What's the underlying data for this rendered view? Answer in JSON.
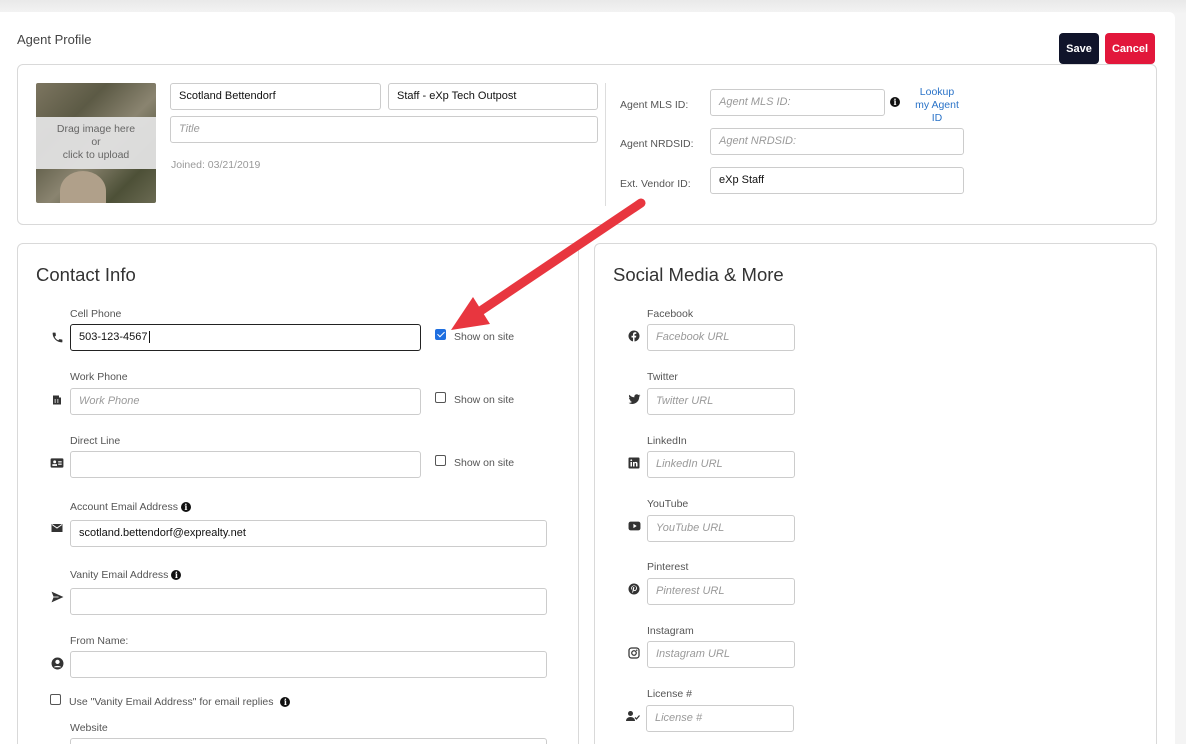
{
  "header": {
    "title": "Agent Profile",
    "save_label": "Save",
    "cancel_label": "Cancel"
  },
  "profile": {
    "photo_hint": [
      "Drag image here",
      "or",
      "click to upload"
    ],
    "name_value": "Scotland Bettendorf",
    "office_value": "Staff - eXp Tech Outpost",
    "title_placeholder": "Title",
    "joined": "Joined: 03/21/2019",
    "mls_label": "Agent MLS ID:",
    "mls_placeholder": "Agent MLS ID:",
    "lookup_link": [
      "Lookup",
      "my Agent",
      "ID"
    ],
    "nrdsid_label": "Agent NRDSID:",
    "nrdsid_placeholder": "Agent NRDSID:",
    "vendor_label": "Ext. Vendor ID:",
    "vendor_value": "eXp Staff"
  },
  "contact": {
    "title": "Contact Info",
    "cell_label": "Cell Phone",
    "cell_value": "503-123-4567",
    "work_label": "Work Phone",
    "work_placeholder": "Work Phone",
    "direct_label": "Direct Line",
    "show_on_site": "Show on site",
    "account_email_label": "Account Email Address",
    "account_email_value": "scotland.bettendorf@exprealty.net",
    "vanity_email_label": "Vanity Email Address",
    "from_name_label": "From Name:",
    "vanity_reply_label": "Use \"Vanity Email Address\" for email replies",
    "website_label": "Website"
  },
  "social": {
    "title": "Social Media & More",
    "facebook_label": "Facebook",
    "facebook_placeholder": "Facebook URL",
    "twitter_label": "Twitter",
    "twitter_placeholder": "Twitter URL",
    "linkedin_label": "LinkedIn",
    "linkedin_placeholder": "LinkedIn URL",
    "youtube_label": "YouTube",
    "youtube_placeholder": "YouTube URL",
    "pinterest_label": "Pinterest",
    "pinterest_placeholder": "Pinterest URL",
    "instagram_label": "Instagram",
    "instagram_placeholder": "Instagram URL",
    "license_label": "License #",
    "license_placeholder": "License #"
  },
  "colors": {
    "save": "#10142a",
    "cancel": "#e2173b",
    "arrow": "#e8363f",
    "link": "#2a73c8",
    "checkbox": "#1f6fe0"
  },
  "icons": [
    "phone-icon",
    "fax-icon",
    "contact-card-icon",
    "envelope-icon",
    "send-icon",
    "user-circle-icon",
    "facebook-icon",
    "twitter-icon",
    "linkedin-icon",
    "youtube-icon",
    "pinterest-icon",
    "instagram-icon",
    "user-check-icon",
    "info-icon"
  ]
}
